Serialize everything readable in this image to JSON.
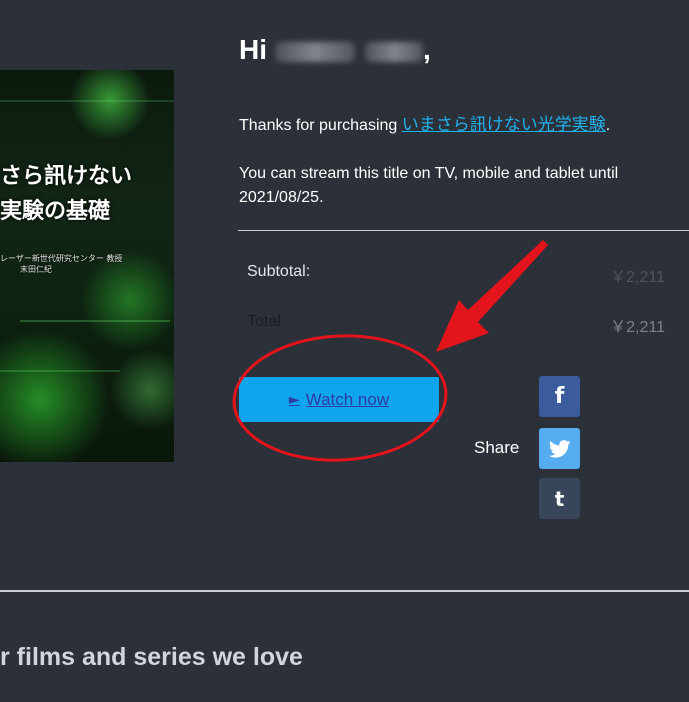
{
  "greeting": {
    "prefix": "Hi",
    "suffix": ","
  },
  "cover": {
    "title_line1": "さら訊けない",
    "title_line2": "実験の基礎",
    "author_line1": "レーザー新世代研究センター 教授",
    "author_line2": "末田仁紀"
  },
  "purchase": {
    "thanks_text": "Thanks for purchasing ",
    "title_link": "いまさら訊けない光学実験",
    "period": ".",
    "stream_text": "You can stream this title on TV, mobile and tablet until 2021/08/25."
  },
  "summary": {
    "subtotal_label": "Subtotal:",
    "subtotal_value": "￥2,211",
    "total_label": "Total",
    "total_value": "￥2,211"
  },
  "actions": {
    "watch_icon": "►",
    "watch_label": "Watch now"
  },
  "share": {
    "label": "Share",
    "facebook_glyph": "f",
    "tumblr_glyph": "t"
  },
  "footer": {
    "heading": "r films and series we love"
  },
  "colors": {
    "background": "#2c3038",
    "link": "#1fb2ee",
    "watch_button": "#0fa4ee",
    "facebook": "#3b5c9c",
    "twitter": "#55acee",
    "tumblr": "#38465c",
    "annotation": "#e3141c"
  }
}
